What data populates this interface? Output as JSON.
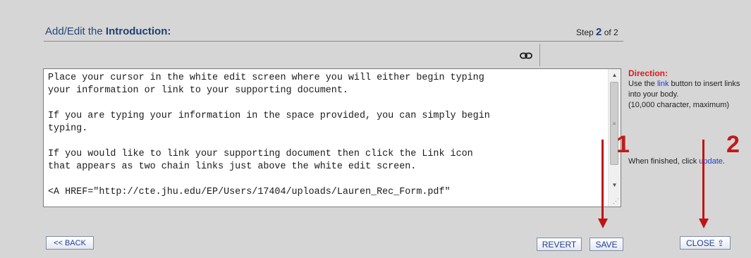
{
  "header": {
    "title_prefix": "Add/Edit the ",
    "title_bold": "Introduction:",
    "step_prefix": "Step ",
    "step_current": "2",
    "step_suffix": " of 2"
  },
  "toolbar": {
    "link_icon": "chain-link-icon"
  },
  "editor": {
    "content": "Place your cursor in the white edit screen where you will either begin typing\nyour information or link to your supporting document.\n\nIf you are typing your information in the space provided, you can simply begin\ntyping.\n\nIf you would like to link your supporting document then click the Link icon\nthat appears as two chain links just above the white edit screen.\n\n<A HREF=\"http://cte.jhu.edu/EP/Users/17404/uploads/Lauren_Rec_Form.pdf\""
  },
  "sidebar": {
    "direction_title": "Direction:",
    "direction_pre": "Use the ",
    "direction_link": "link",
    "direction_post": " button to insert links into your body.",
    "char_limit": "(10,000 character, maximum)",
    "finished_pre": "When finished, click ",
    "finished_link": "update",
    "finished_post": "."
  },
  "annotations": {
    "marker_1": "1",
    "marker_2": "2",
    "color": "#c01414"
  },
  "buttons": {
    "back": "<< BACK",
    "revert": "REVERT",
    "save": "SAVE",
    "close": "CLOSE ⇪"
  }
}
